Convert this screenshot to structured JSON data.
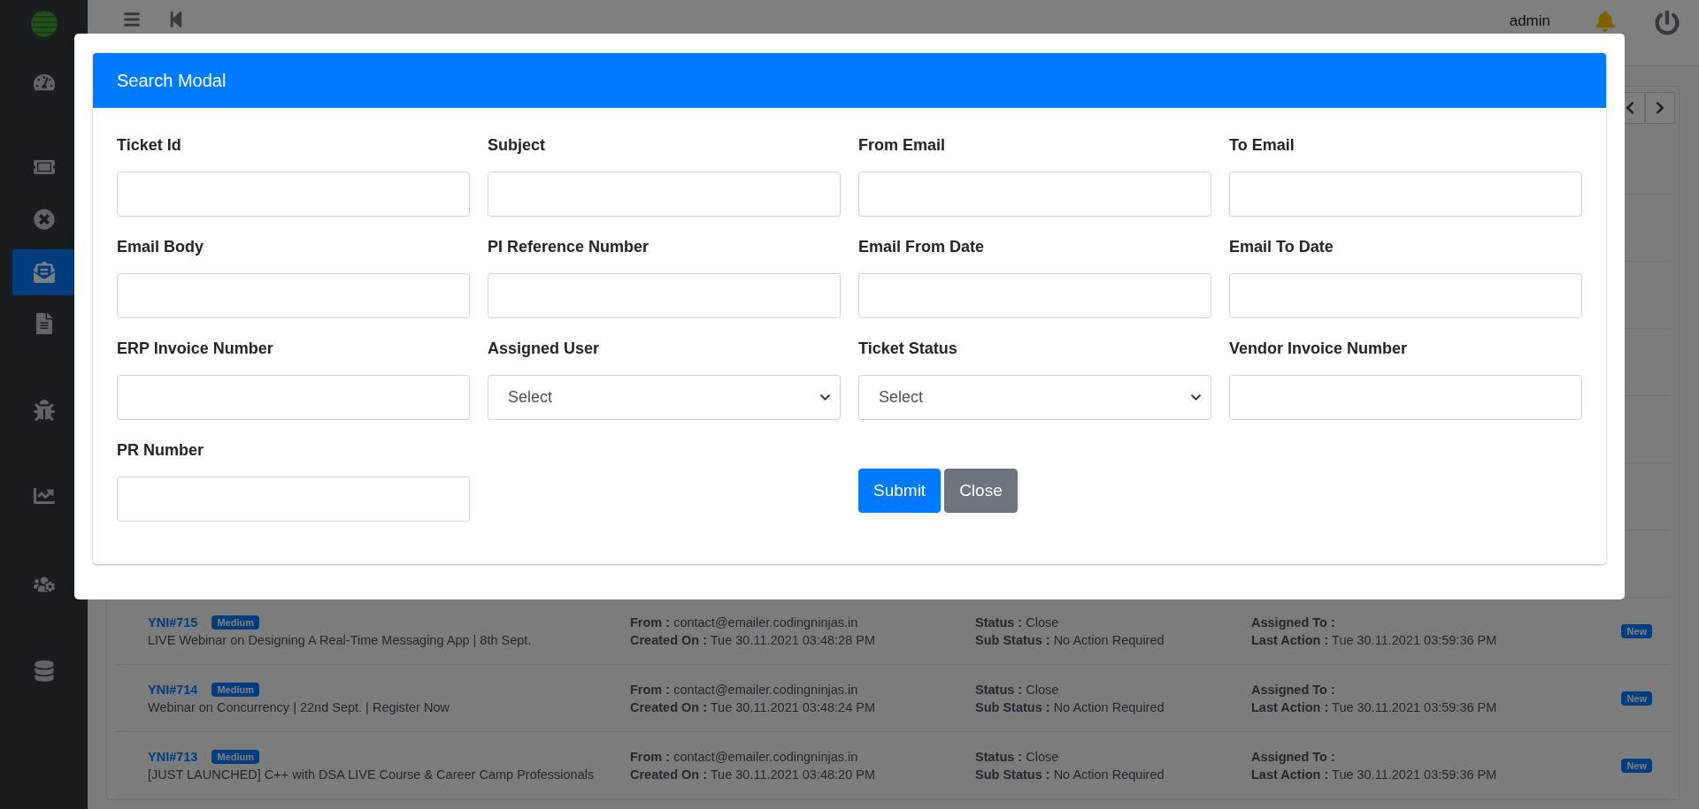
{
  "sidebar": {
    "items": [
      {
        "kind": "dashboard",
        "selected": false
      },
      {
        "kind": "ticket",
        "selected": false
      },
      {
        "kind": "cancel",
        "selected": false
      },
      {
        "kind": "mail",
        "selected": true
      },
      {
        "kind": "file",
        "selected": false
      },
      {
        "kind": "bug",
        "selected": false
      },
      {
        "kind": "chart",
        "selected": false
      },
      {
        "kind": "users",
        "selected": false
      },
      {
        "kind": "database",
        "selected": false
      }
    ]
  },
  "header": {
    "user": "admin"
  },
  "modal": {
    "title": "Search Modal",
    "fields": [
      {
        "label": "Ticket Id",
        "kind": "text"
      },
      {
        "label": "Subject",
        "kind": "text"
      },
      {
        "label": "From Email",
        "kind": "text"
      },
      {
        "label": "To Email",
        "kind": "text"
      },
      {
        "label": "Email Body",
        "kind": "text"
      },
      {
        "label": "PI Reference Number",
        "kind": "text"
      },
      {
        "label": "Email From Date",
        "kind": "text"
      },
      {
        "label": "Email To Date",
        "kind": "text"
      },
      {
        "label": "ERP Invoice Number",
        "kind": "text"
      },
      {
        "label": "Assigned User",
        "kind": "select",
        "value": "Select"
      },
      {
        "label": "Ticket Status",
        "kind": "select",
        "value": "Select"
      },
      {
        "label": "Vendor Invoice Number",
        "kind": "text"
      },
      {
        "label": "PR Number",
        "kind": "text"
      }
    ],
    "buttons": [
      {
        "label": "Submit",
        "kind": "primary"
      },
      {
        "label": "Close",
        "kind": "secondary"
      }
    ]
  },
  "tickets": [
    {
      "id": "YNI#715",
      "priority": "Medium",
      "subject": "LIVE Webinar on Designing A Real-Time Messaging App | 8th Sept.",
      "from_label": "From :",
      "from": "contact@emailer.codingninjas.in",
      "created_label": "Created On :",
      "created": "Tue 30.11.2021 03:48:28 PM",
      "status_label": "Status :",
      "status": "Close",
      "sub_status_label": "Sub Status :",
      "sub_status": "No Action Required",
      "assigned_label": "Assigned To :",
      "last_action_label": "Last Action :",
      "last_action": "Tue 30.11.2021 03:59:36 PM",
      "badge": "New"
    },
    {
      "id": "YNI#714",
      "priority": "Medium",
      "subject": "Webinar on Concurrency | 22nd Sept. | Register Now",
      "from_label": "From :",
      "from": "contact@emailer.codingninjas.in",
      "created_label": "Created On :",
      "created": "Tue 30.11.2021 03:48:24 PM",
      "status_label": "Status :",
      "status": "Close",
      "sub_status_label": "Sub Status :",
      "sub_status": "No Action Required",
      "assigned_label": "Assigned To :",
      "last_action_label": "Last Action :",
      "last_action": "Tue 30.11.2021 03:59:36 PM",
      "badge": "New"
    },
    {
      "id": "YNI#713",
      "priority": "Medium",
      "subject": "[JUST LAUNCHED] C++ with DSA LIVE Course & Career Camp Professionals",
      "from_label": "From :",
      "from": "contact@emailer.codingninjas.in",
      "created_label": "Created On :",
      "created": "Tue 30.11.2021 03:48:20 PM",
      "status_label": "Status :",
      "status": "Close",
      "sub_status_label": "Sub Status :",
      "sub_status": "No Action Required",
      "assigned_label": "Assigned To :",
      "last_action_label": "Last Action :",
      "last_action": "Tue 30.11.2021 03:59:36 PM",
      "badge": "New"
    }
  ]
}
